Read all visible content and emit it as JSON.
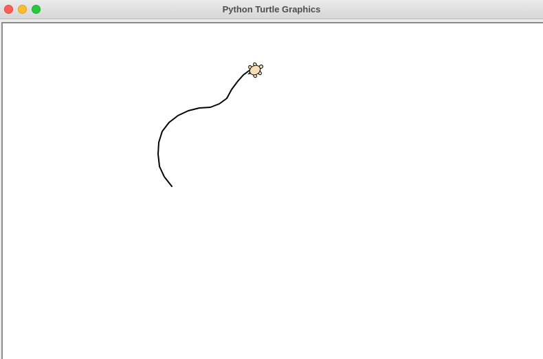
{
  "window": {
    "title": "Python Turtle Graphics",
    "controls": {
      "close": "close-button",
      "minimize": "minimize-button",
      "zoom": "zoom-button"
    }
  },
  "colors": {
    "close": "#fe5f57",
    "minimize": "#febc2e",
    "zoom": "#28c840",
    "pen": "#000000",
    "turtle_fill": "#f5deb3",
    "canvas": "#ffffff"
  },
  "turtle": {
    "icon": "turtle-icon",
    "shape": "turtle"
  }
}
